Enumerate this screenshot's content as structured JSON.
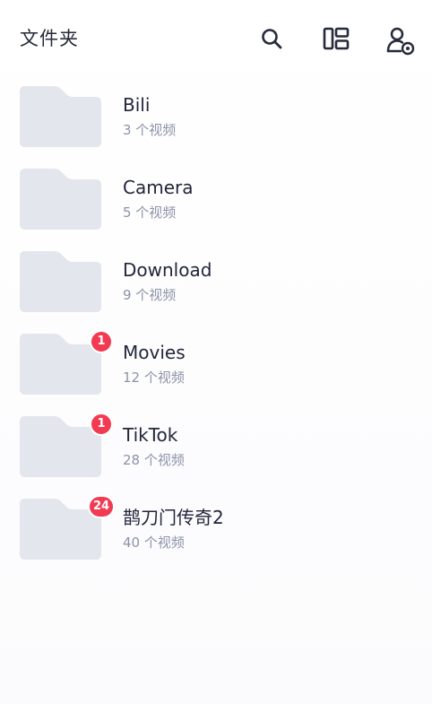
{
  "header": {
    "title": "文件夹",
    "icons": [
      "search-icon",
      "layout-icon",
      "user-settings-icon"
    ]
  },
  "folders": [
    {
      "name": "Bili",
      "count": "3 个视频"
    },
    {
      "name": "Camera",
      "count": "5 个视频"
    },
    {
      "name": "Download",
      "count": "9 个视频"
    },
    {
      "name": "Movies",
      "count": "12 个视频",
      "badge": "1"
    },
    {
      "name": "TikTok",
      "count": "28 个视频",
      "badge": "1"
    },
    {
      "name": "鹊刀门传奇2",
      "count": "40 个视频",
      "badge": "24"
    }
  ],
  "colors": {
    "folder": "#e3e6ec",
    "badge": "#f23a52",
    "title_text": "#23263a",
    "sub_text": "#8d93a8"
  }
}
